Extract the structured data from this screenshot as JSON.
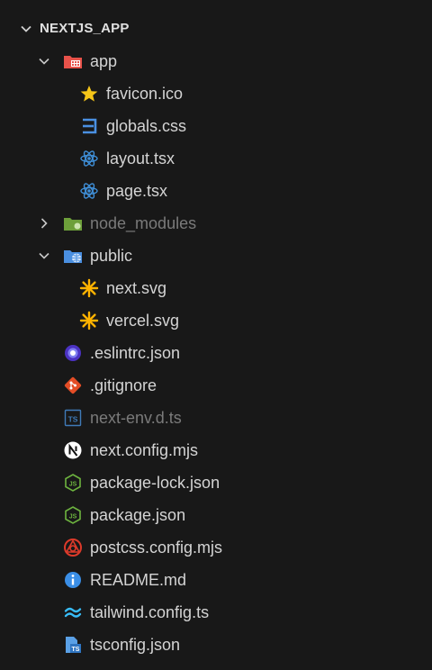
{
  "explorer": {
    "root": {
      "label": "NEXTJS_APP"
    },
    "items": [
      {
        "label": "app",
        "icon": "app-folder-icon"
      },
      {
        "label": "favicon.ico",
        "icon": "star-icon"
      },
      {
        "label": "globals.css",
        "icon": "css-icon"
      },
      {
        "label": "layout.tsx",
        "icon": "react-icon"
      },
      {
        "label": "page.tsx",
        "icon": "react-icon"
      },
      {
        "label": "node_modules",
        "icon": "node-folder-icon"
      },
      {
        "label": "public",
        "icon": "public-folder-icon"
      },
      {
        "label": "next.svg",
        "icon": "svg-icon"
      },
      {
        "label": "vercel.svg",
        "icon": "svg-icon"
      },
      {
        "label": ".eslintrc.json",
        "icon": "eslint-icon"
      },
      {
        "label": ".gitignore",
        "icon": "git-icon"
      },
      {
        "label": "next-env.d.ts",
        "icon": "typescript-icon"
      },
      {
        "label": "next.config.mjs",
        "icon": "next-icon"
      },
      {
        "label": "package-lock.json",
        "icon": "nodejs-icon"
      },
      {
        "label": "package.json",
        "icon": "nodejs-icon"
      },
      {
        "label": "postcss.config.mjs",
        "icon": "postcss-icon"
      },
      {
        "label": "README.md",
        "icon": "info-icon"
      },
      {
        "label": "tailwind.config.ts",
        "icon": "tailwind-icon"
      },
      {
        "label": "tsconfig.json",
        "icon": "tsconfig-icon"
      }
    ]
  },
  "colors": {
    "background": "#181818",
    "text": "#d4d4d4",
    "dimmed_text": "#7a7a7a",
    "react": "#3f8fd8",
    "star": "#f5c518",
    "svg": "#ffb300",
    "git": "#e44d26",
    "node": "#6db33f",
    "info": "#3a8ee6"
  }
}
